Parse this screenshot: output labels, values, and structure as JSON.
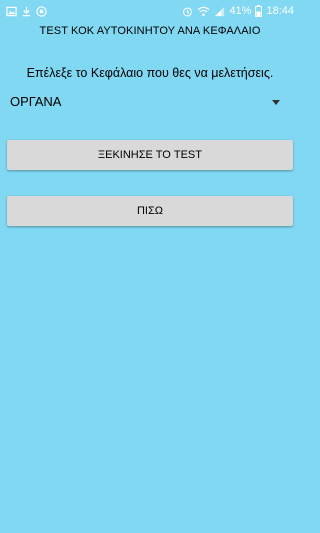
{
  "status_bar": {
    "battery_percent": "41%",
    "time": "18:44",
    "icons": [
      "image-icon",
      "download-icon",
      "app-icon",
      "alarm-icon",
      "wifi-icon",
      "signal-icon",
      "battery-icon"
    ]
  },
  "header": {
    "title": "TEST ΚΟΚ ΑΥΤΟΚΙΝΗΤΟΥ ΑΝΑ ΚΕΦΑΛΑΙΟ"
  },
  "main": {
    "prompt": "Επέλεξε το Κεφάλαιο που θες να μελετήσεις.",
    "chapter_select": {
      "selected": "ΟΡΓΑΝΑ"
    },
    "start_button_label": "ΞΕΚΙΝΗΣΕ ΤΟ TEST",
    "back_button_label": "ΠΙΣΩ"
  },
  "colors": {
    "background": "#80d8f2",
    "button": "#d9d9d9",
    "status_text": "#ffffff"
  }
}
